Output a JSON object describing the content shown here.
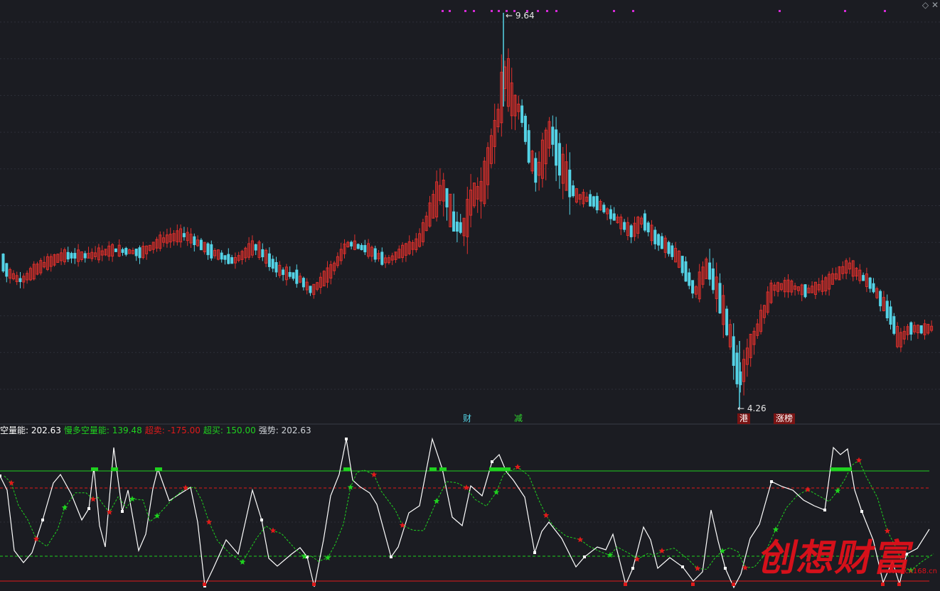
{
  "colors": {
    "background": "#1b1c22",
    "grid": "#2c2e38",
    "up": "#e0302c",
    "down": "#54d3e6",
    "white_line": "#ffffff",
    "green": "#1fd11f",
    "red": "#e01a1a",
    "magenta": "#d42bd6"
  },
  "price_chart": {
    "high_marker": "9.64",
    "low_marker": "4.26",
    "annotations": [
      {
        "text": "财",
        "color": "#54d3e6",
        "bg": "none"
      },
      {
        "text": "减",
        "color": "#2fd42f",
        "bg": "none"
      },
      {
        "text": "港",
        "color": "#ffffff",
        "bg": "#7a1414"
      },
      {
        "text": "涨榜",
        "color": "#ffffff",
        "bg": "#7a1414"
      }
    ],
    "icons": [
      "diamond-icon",
      "close-icon"
    ]
  },
  "indicator": {
    "legend": [
      {
        "label": "空量能:",
        "value": "202.63",
        "color": "#ffffff"
      },
      {
        "label": "慢多空量能:",
        "value": "139.48",
        "color": "#1fd11f"
      },
      {
        "label": "超卖:",
        "value": "-175.00",
        "color": "#e01a1a"
      },
      {
        "label": "超买:",
        "value": "150.00",
        "color": "#1fd11f"
      },
      {
        "label": "强势:",
        "value": "202.63",
        "color": "#cfd3d8"
      }
    ],
    "levels": {
      "overbought": 150.0,
      "oversold": -175.0,
      "strong": 100,
      "weak": -100
    }
  },
  "watermark": {
    "text": "创想财富",
    "url": "www.cx168.cn"
  }
}
